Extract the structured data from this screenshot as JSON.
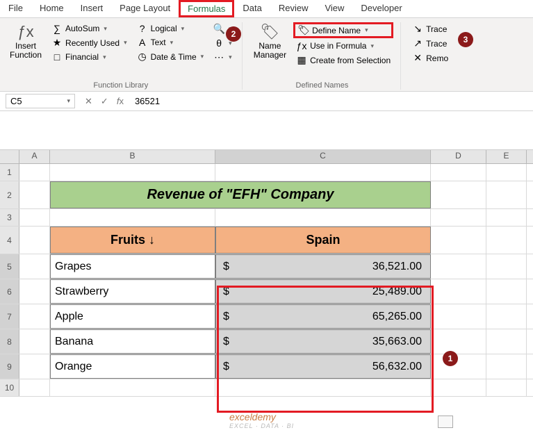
{
  "tabs": [
    "File",
    "Home",
    "Insert",
    "Page Layout",
    "Formulas",
    "Data",
    "Review",
    "View",
    "Developer"
  ],
  "ribbon": {
    "insertFunction": "Insert\nFunction",
    "lib": {
      "autosum": "AutoSum",
      "recent": "Recently Used",
      "financial": "Financial",
      "logical": "Logical",
      "text": "Text",
      "datetime": "Date & Time"
    },
    "libLabel": "Function Library",
    "nameMgr": "Name\nManager",
    "define": "Define Name",
    "useIn": "Use in Formula",
    "createFrom": "Create from Selection",
    "defLabel": "Defined Names",
    "trace1": "Trace",
    "trace2": "Trace",
    "remo": "Remo"
  },
  "fbar": {
    "name": "C5",
    "value": "36521"
  },
  "colHeaders": [
    "A",
    "B",
    "C",
    "D",
    "E"
  ],
  "rowHeaders": [
    "1",
    "2",
    "3",
    "4",
    "5",
    "6",
    "7",
    "8",
    "9",
    "10"
  ],
  "table": {
    "title": "Revenue of \"EFH\" Company",
    "h1": "Fruits ↓",
    "h2": "Spain",
    "rows": [
      {
        "fruit": "Grapes",
        "val": "36,521.00"
      },
      {
        "fruit": "Strawberry",
        "val": "25,489.00"
      },
      {
        "fruit": "Apple",
        "val": "65,265.00"
      },
      {
        "fruit": "Banana",
        "val": "35,663.00"
      },
      {
        "fruit": "Orange",
        "val": "56,632.00"
      }
    ]
  },
  "badges": {
    "b1": "1",
    "b2": "2",
    "b3": "3"
  },
  "wm": {
    "main": "exceldemy",
    "sub": "EXCEL · DATA · BI"
  }
}
